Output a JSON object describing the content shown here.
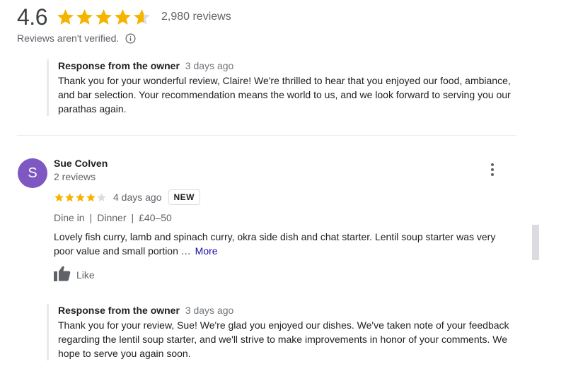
{
  "summary": {
    "rating": "4.6",
    "stars": 4.6,
    "review_count": "2,980 reviews",
    "verification_note": "Reviews aren't verified."
  },
  "reply_1": {
    "author": "Response from the owner",
    "time": "3 days ago",
    "text": "Thank you for your wonderful review, Claire! We're thrilled to hear that you enjoyed our food, ambiance, and bar selection. Your recommendation means the world to us, and we look forward to serving you our parathas again."
  },
  "review": {
    "avatar_letter": "S",
    "avatar_color": "#7e57c2",
    "name": "Sue Colven",
    "reviewer_reviews": "2 reviews",
    "stars": 4,
    "time": "4 days ago",
    "badge": "NEW",
    "attributes": [
      "Dine in",
      "Dinner",
      "£40–50"
    ],
    "attribute_separator": "|",
    "text": "Lovely fish curry, lamb and spinach curry, okra side dish and chat starter. Lentil soup starter was very poor value and small portion …",
    "more_label": "More",
    "like_label": "Like"
  },
  "reply_2": {
    "author": "Response from the owner",
    "time": "3 days ago",
    "text": "Thank you for your review, Sue! We're glad you enjoyed our dishes. We've taken note of your feedback regarding the lentil soup starter, and we'll strive to make improvements in honor of your comments. We hope to serve you again soon."
  },
  "colors": {
    "star_filled": "#f4b400",
    "star_empty": "#dadce0",
    "link": "#1a0dab"
  },
  "icons": [
    "star-icon",
    "info-icon",
    "more-options-icon",
    "thumbs-up-icon"
  ]
}
